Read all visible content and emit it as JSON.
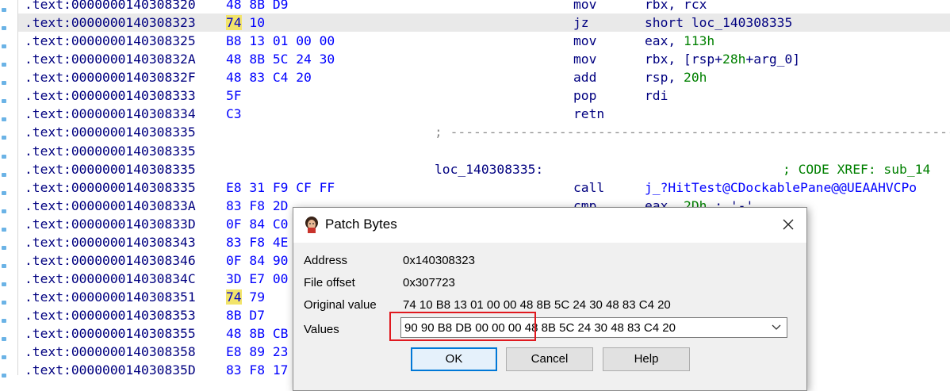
{
  "listing": [
    {
      "addr": ".text:0000000140308320",
      "bytes_hl": "",
      "bytes": "48 8B D9",
      "mnemonic": "mov",
      "operand": "rbx, rcx"
    },
    {
      "addr": ".text:0000000140308323",
      "bytes_hl": "74",
      "bytes": " 10",
      "mnemonic": "jz",
      "operand": "short loc_140308335",
      "selected": true
    },
    {
      "addr": ".text:0000000140308325",
      "bytes_hl": "",
      "bytes": "B8 13 01 00 00",
      "mnemonic": "mov",
      "operand": "eax, 113h"
    },
    {
      "addr": ".text:000000014030832A",
      "bytes_hl": "",
      "bytes": "48 8B 5C 24 30",
      "mnemonic": "mov",
      "operand": "rbx, [rsp+28h+arg_0]"
    },
    {
      "addr": ".text:000000014030832F",
      "bytes_hl": "",
      "bytes": "48 83 C4 20",
      "mnemonic": "add",
      "operand": "rsp, 20h"
    },
    {
      "addr": ".text:0000000140308333",
      "bytes_hl": "",
      "bytes": "5F",
      "mnemonic": "pop",
      "operand": "rdi"
    },
    {
      "addr": ".text:0000000140308334",
      "bytes_hl": "",
      "bytes": "C3",
      "mnemonic": "retn",
      "operand": ""
    },
    {
      "addr": ".text:0000000140308335",
      "separator": "; -----------------------------------------------------------------"
    },
    {
      "addr": ".text:0000000140308335"
    },
    {
      "addr": ".text:0000000140308335",
      "label": "loc_140308335:",
      "xref": "; CODE XREF: sub_14"
    },
    {
      "addr": ".text:0000000140308335",
      "bytes_hl": "",
      "bytes": "E8 31 F9 CF FF",
      "mnemonic": "call",
      "operand": "j_?HitTest@CDockablePane@@UEAAHVCPo"
    },
    {
      "addr": ".text:000000014030833A",
      "bytes_hl": "",
      "bytes": "83 F8 2D",
      "mnemonic": "cmp",
      "operand": "eax, 2Dh ; '-'"
    },
    {
      "addr": ".text:000000014030833D",
      "bytes_hl": "",
      "bytes": "0F 84 C0"
    },
    {
      "addr": ".text:0000000140308343",
      "bytes_hl": "",
      "bytes": "83 F8 4E"
    },
    {
      "addr": ".text:0000000140308346",
      "bytes_hl": "",
      "bytes": "0F 84 90"
    },
    {
      "addr": ".text:000000014030834C",
      "bytes_hl": "",
      "bytes": "3D E7 00"
    },
    {
      "addr": ".text:0000000140308351",
      "bytes_hl": "74",
      "bytes": " 79"
    },
    {
      "addr": ".text:0000000140308353",
      "bytes_hl": "",
      "bytes": "8B D7"
    },
    {
      "addr": ".text:0000000140308355",
      "bytes_hl": "",
      "bytes": "48 8B CB"
    },
    {
      "addr": ".text:0000000140308358",
      "bytes_hl": "",
      "bytes": "E8 89 23"
    },
    {
      "addr": ".text:000000014030835D",
      "bytes_hl": "",
      "bytes": "83 F8 17"
    }
  ],
  "dialog": {
    "title": "Patch Bytes",
    "fields": [
      {
        "label": "Address",
        "value": "0x140308323"
      },
      {
        "label": "File offset",
        "value": "0x307723"
      },
      {
        "label": "Original value",
        "value": "74 10 B8 13 01 00 00 48 8B 5C 24 30 48 83 C4 20"
      }
    ],
    "values_label": "Values",
    "values_text": "90 90 B8 DB 00 00 00 48 8B 5C 24 30 48 83 C4 20",
    "buttons": {
      "ok": "OK",
      "cancel": "Cancel",
      "help": "Help"
    }
  },
  "colors": {
    "highlight": "#f2e46a",
    "red_box": "#e0191f",
    "address": "#000080",
    "bytes": "#0000ff",
    "number": "#008000"
  },
  "icons": {
    "app_icon": "ida-icon",
    "close": "close-icon",
    "dropdown": "chevron-down-icon"
  }
}
